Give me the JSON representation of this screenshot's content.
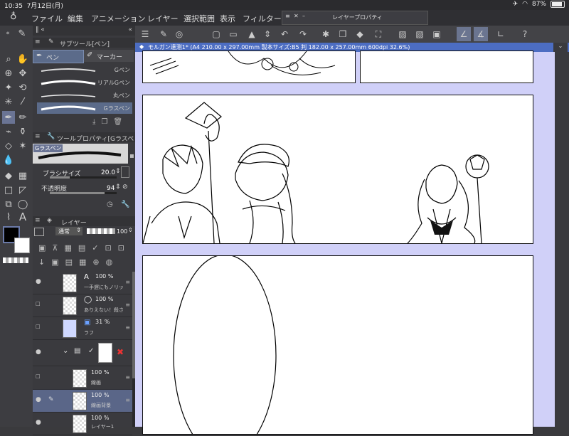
{
  "status": {
    "time": "10:35",
    "date": "7月12日(月)",
    "battery": "87%",
    "battery_level": 0.87
  },
  "menu": [
    "ファイル",
    "編集",
    "アニメーション",
    "レイヤー",
    "選択範囲",
    "表示",
    "フィルター"
  ],
  "layer_property_title": "レイヤープロパティ",
  "document_tab": "モルガン達测1* (A4 210.00 x 297.00mm 製本サイズ:B5 判 182.00 x 257.00mm 600dpi 32.6%)",
  "subtool_panel": {
    "title": "サブツール[ペン]",
    "tabs": [
      "ペン",
      "マーカー"
    ],
    "brushes": [
      "Gペン",
      "リアルGペン",
      "丸ペン",
      "Gラスペン"
    ]
  },
  "tool_property": {
    "title": "ツールプロパティ[Gラスペン",
    "brush_name": "Gラスペン",
    "size_label": "ブラシサイズ",
    "size_value": "20.0",
    "opacity_label": "不透明度",
    "opacity_value": "94"
  },
  "layer_panel": {
    "title": "レイヤー",
    "blend_mode": "通常",
    "opacity": "100",
    "layers": [
      {
        "pct": "100 %",
        "name": "一手遅にもノリッ"
      },
      {
        "pct": "100 %",
        "name": "ありえない！殺さ"
      },
      {
        "pct": "31 %",
        "name": "ラフ"
      },
      {
        "pct": "",
        "name": ""
      },
      {
        "pct": "100 %",
        "name": "線画"
      },
      {
        "pct": "100 %",
        "name": "線画背景"
      },
      {
        "pct": "100 %",
        "name": "レイヤー1"
      }
    ]
  }
}
